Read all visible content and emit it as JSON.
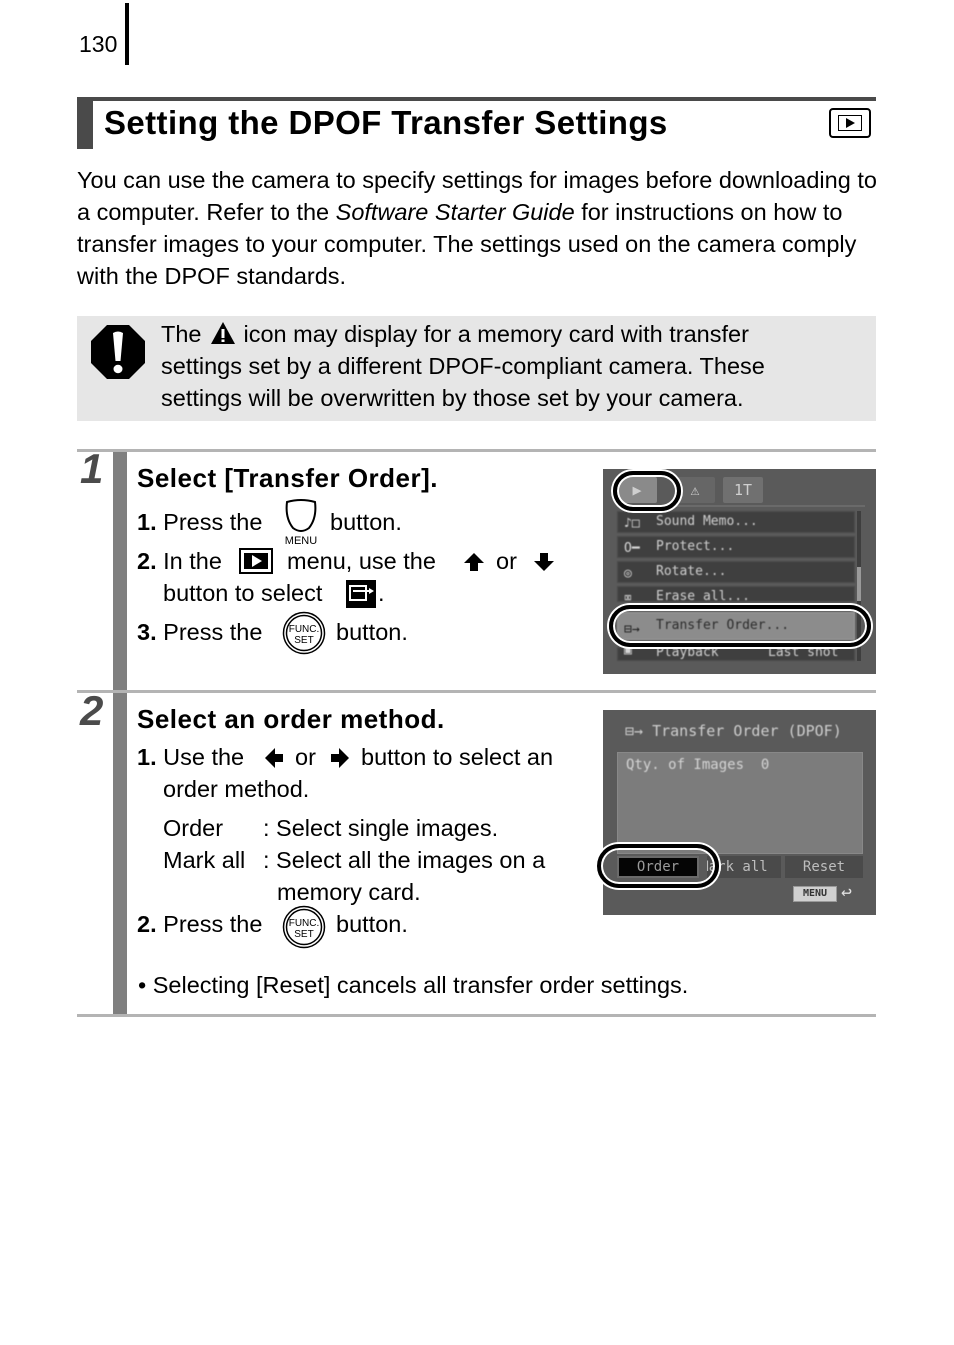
{
  "page": {
    "number": "130"
  },
  "header": {
    "title": "Setting the DPOF Transfer Settings",
    "mode_icon": "playback-mode-icon"
  },
  "intro": {
    "part1": "You can use the camera to specify settings for images before downloading to a computer. Refer to the ",
    "guide_name": "Software Starter Guide",
    "part2": " for instructions on how to transfer images to your computer. The settings used on the camera comply with the DPOF standards."
  },
  "caution": {
    "icon": "caution-stop-icon",
    "pre": "The",
    "inline_icon": "warning-triangle-icon",
    "line1_post": "icon may display for a memory card with transfer",
    "line2": "settings set by a different DPOF-compliant camera. These",
    "line3": "settings will be overwritten by those set by your camera."
  },
  "steps": [
    {
      "number": "1",
      "title": "Select [Transfer Order].",
      "instructions": [
        {
          "num": "1.",
          "pre": "Press the",
          "icon": "menu-button-icon",
          "icon_label": "MENU",
          "post": "button."
        },
        {
          "num": "2.",
          "pre": "In the",
          "icon": "playback-menu-icon",
          "mid": "menu, use the",
          "icon2": "up-arrow-icon",
          "or": "or",
          "icon3": "down-arrow-icon",
          "line2_pre": "button to select",
          "icon4": "transfer-order-icon",
          "line2_post": "."
        },
        {
          "num": "3.",
          "pre": "Press the",
          "icon": "func-set-button-icon",
          "icon_label_top": "FUNC.",
          "icon_label_bottom": "SET",
          "post": "button."
        }
      ],
      "screen": {
        "tabs": [
          "▶",
          "⚠",
          "1T"
        ],
        "menu_items": [
          {
            "icon": "sound-memo-icon",
            "label": "Sound Memo..."
          },
          {
            "icon": "protect-key-icon",
            "label": "Protect..."
          },
          {
            "icon": "rotate-icon",
            "label": "Rotate..."
          },
          {
            "icon": "erase-icon",
            "label": "Erase all..."
          },
          {
            "icon": "transfer-order-icon",
            "label": "Transfer Order...",
            "selected": true
          },
          {
            "icon": "playback-icon",
            "label": "Playback",
            "value": "Last shot"
          }
        ]
      }
    },
    {
      "number": "2",
      "title": "Select an order method.",
      "instructions": [
        {
          "num": "1.",
          "pre": "Use the",
          "icon": "left-arrow-icon",
          "or": "or",
          "icon2": "right-arrow-icon",
          "post": "button to select an",
          "line2": "order method."
        },
        {
          "num": "2.",
          "pre": "Press the",
          "icon": "func-set-button-icon",
          "icon_label_top": "FUNC.",
          "icon_label_bottom": "SET",
          "post": "button."
        }
      ],
      "options": [
        {
          "name": "Order",
          "desc": ": Select single images."
        },
        {
          "name": "Mark all",
          "desc": ": Select all the images on a",
          "desc2": "memory card."
        }
      ],
      "screen": {
        "title": "Transfer Order (DPOF)",
        "qty_label": "Qty. of Images",
        "qty_value": "0",
        "buttons": [
          "Order",
          "Mark all",
          "Reset"
        ],
        "selected_button": "Order",
        "footer_label": "MENU"
      },
      "note": "• Selecting [Reset] cancels all transfer order settings."
    }
  ]
}
